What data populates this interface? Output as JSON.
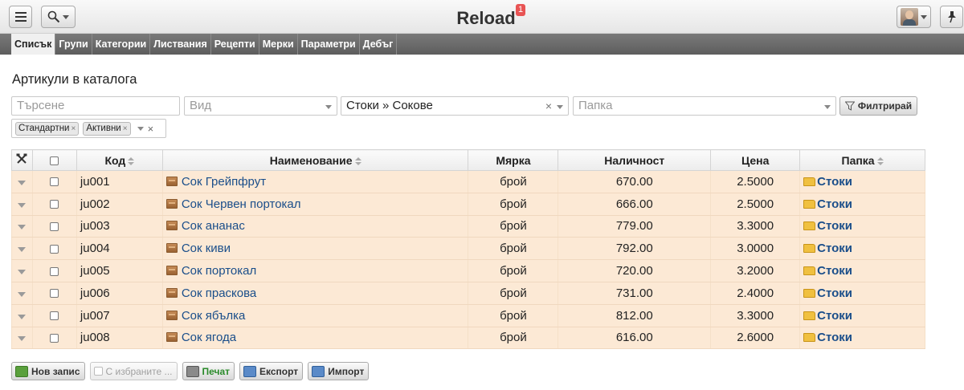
{
  "app": {
    "title": "Reload",
    "notification_count": "1"
  },
  "tabs": [
    {
      "label": "Списък",
      "active": true
    },
    {
      "label": "Групи"
    },
    {
      "label": "Категории"
    },
    {
      "label": "Листвания"
    },
    {
      "label": "Рецепти"
    },
    {
      "label": "Мерки"
    },
    {
      "label": "Параметри"
    },
    {
      "label": "Дебъг"
    }
  ],
  "page": {
    "heading": "Артикули в каталога"
  },
  "filters": {
    "search_placeholder": "Търсене",
    "type_placeholder": "Вид",
    "group_value": "Стоки » Сокове",
    "folder_placeholder": "Папка",
    "filter_button": "Филтрирай",
    "tags": [
      "Стандартни",
      "Активни"
    ]
  },
  "table": {
    "headers": {
      "code": "Код",
      "name": "Наименование",
      "measure": "Мярка",
      "quantity": "Наличност",
      "price": "Цена",
      "folder": "Папка"
    },
    "rows": [
      {
        "code": "ju001",
        "name": "Сок Грейпфрут",
        "measure": "брой",
        "quantity": "670.00",
        "price": "2.5000",
        "folder": "Стоки"
      },
      {
        "code": "ju002",
        "name": "Сок Червен портокал",
        "measure": "брой",
        "quantity": "666.00",
        "price": "2.5000",
        "folder": "Стоки"
      },
      {
        "code": "ju003",
        "name": "Сок ананас",
        "measure": "брой",
        "quantity": "779.00",
        "price": "3.3000",
        "folder": "Стоки"
      },
      {
        "code": "ju004",
        "name": "Сок киви",
        "measure": "брой",
        "quantity": "792.00",
        "price": "3.0000",
        "folder": "Стоки"
      },
      {
        "code": "ju005",
        "name": "Сок портокал",
        "measure": "брой",
        "quantity": "720.00",
        "price": "3.2000",
        "folder": "Стоки"
      },
      {
        "code": "ju006",
        "name": "Сок праскова",
        "measure": "брой",
        "quantity": "731.00",
        "price": "2.4000",
        "folder": "Стоки"
      },
      {
        "code": "ju007",
        "name": "Сок ябълка",
        "measure": "брой",
        "quantity": "812.00",
        "price": "3.3000",
        "folder": "Стоки"
      },
      {
        "code": "ju008",
        "name": "Сок ягода",
        "measure": "брой",
        "quantity": "616.00",
        "price": "2.6000",
        "folder": "Стоки"
      }
    ]
  },
  "actions": {
    "new_record": "Нов запис",
    "with_selected": "С избраните ...",
    "print": "Печат",
    "export": "Експорт",
    "import": "Импорт"
  }
}
